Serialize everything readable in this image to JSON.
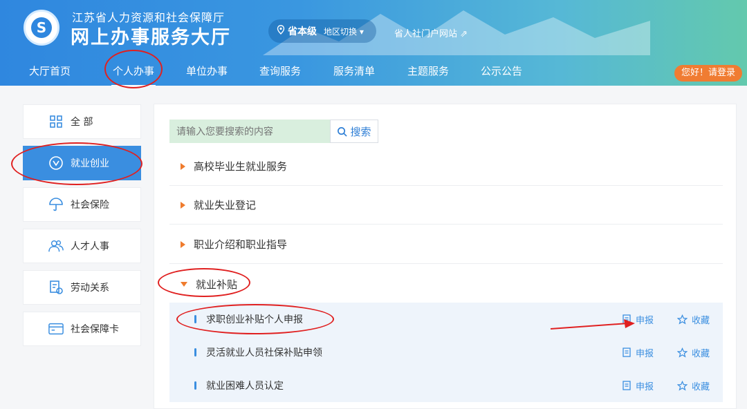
{
  "header": {
    "org_name": "江苏省人力资源和社会保障厅",
    "site_title": "网上办事服务大厅",
    "logo_glyph": "S",
    "region": {
      "level": "省本级",
      "switch_label": "地区切换 ▾"
    },
    "portal_link": "省人社门户网站 ⇗",
    "login_label": "您好！请登录",
    "nav": [
      {
        "label": "大厅首页"
      },
      {
        "label": "个人办事"
      },
      {
        "label": "单位办事"
      },
      {
        "label": "查询服务"
      },
      {
        "label": "服务清单"
      },
      {
        "label": "主题服务"
      },
      {
        "label": "公示公告"
      }
    ]
  },
  "sidebar": {
    "items": [
      {
        "label": "全 部",
        "icon": "grid-icon"
      },
      {
        "label": "就业创业",
        "icon": "employment-icon"
      },
      {
        "label": "社会保险",
        "icon": "umbrella-icon"
      },
      {
        "label": "人才人事",
        "icon": "people-icon"
      },
      {
        "label": "劳动关系",
        "icon": "document-icon"
      },
      {
        "label": "社会保障卡",
        "icon": "card-icon"
      }
    ]
  },
  "main": {
    "search": {
      "placeholder": "请输入您要搜索的内容",
      "button_label": "搜索"
    },
    "categories": [
      {
        "label": "高校毕业生就业服务",
        "expanded": false
      },
      {
        "label": "就业失业登记",
        "expanded": false
      },
      {
        "label": "职业介绍和职业指导",
        "expanded": false
      },
      {
        "label": "就业补贴",
        "expanded": true
      }
    ],
    "sub_items": [
      {
        "label": "求职创业补贴个人申报",
        "apply_label": "申报",
        "favorite_label": "收藏"
      },
      {
        "label": "灵活就业人员社保补贴申领",
        "apply_label": "申报",
        "favorite_label": "收藏"
      },
      {
        "label": "就业困难人员认定",
        "apply_label": "申报",
        "favorite_label": "收藏"
      }
    ]
  },
  "colors": {
    "primary": "#3a8ee0",
    "accent": "#ef7b2d",
    "annotation": "#e02020"
  }
}
